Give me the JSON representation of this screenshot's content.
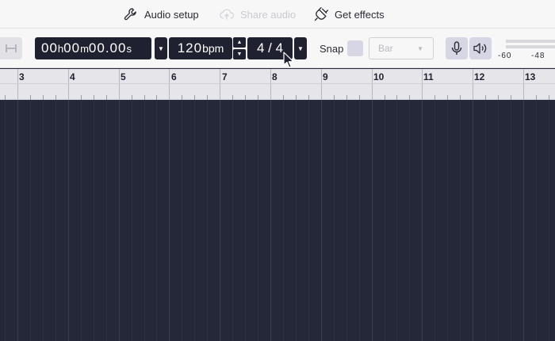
{
  "menu": {
    "audio_setup": "Audio setup",
    "share_audio": "Share audio",
    "get_effects": "Get effects"
  },
  "toolbar": {
    "time": {
      "h": "00",
      "h_unit": "h",
      "m": "00",
      "m_unit": "m",
      "s": "00.00",
      "s_unit": "s"
    },
    "tempo": {
      "value": "120",
      "unit": "bpm"
    },
    "time_signature": "4 / 4",
    "snap_label": "Snap",
    "snap_value": "Bar",
    "meter_labels": [
      "-60",
      "-48"
    ]
  },
  "ruler": {
    "bars": [
      "3",
      "4",
      "5",
      "6",
      "7",
      "8",
      "9",
      "10",
      "11",
      "12",
      "13"
    ]
  },
  "colors": {
    "timeline_bg": "#252838",
    "ruler_bg": "#e6e6ea",
    "toolbar_bg": "#f7f7f8",
    "dark": "#1f2130"
  }
}
